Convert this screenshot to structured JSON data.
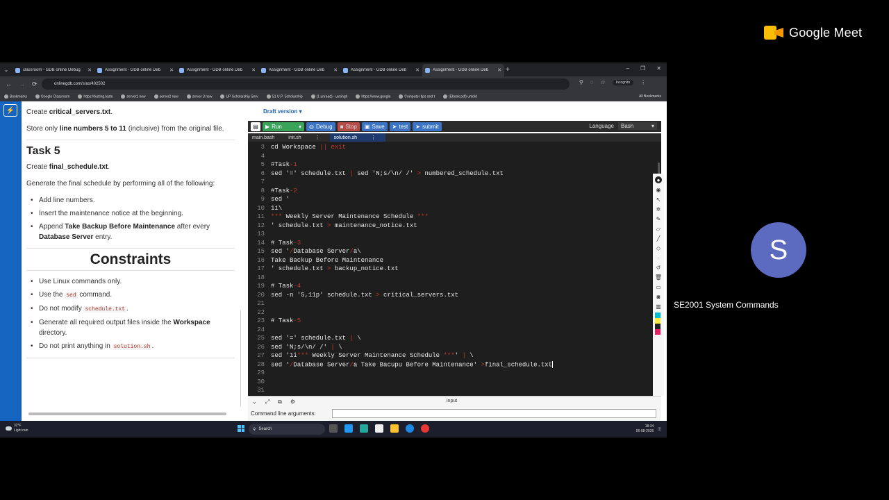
{
  "meet": {
    "brand": "Google Meet",
    "participant_initial": "S",
    "participant_name": "SE2001 System Commands",
    "avatar_color": "#5c6bc0"
  },
  "browser": {
    "tabs": [
      {
        "label": "classroom - GDB online Debug"
      },
      {
        "label": "Assignment - GDB online Deb"
      },
      {
        "label": "Assignment - GDB online Deb"
      },
      {
        "label": "Assignment - GDB online Deb"
      },
      {
        "label": "Assignment - GDB online Deb"
      },
      {
        "label": "Assignment - GDB online Deb",
        "active": true
      }
    ],
    "url": "onlinegdb.com/s/as/402502",
    "incognito_label": "Incognito",
    "bookmarks": [
      "Bookmarks",
      "Google Classroom",
      "https://testing.teste",
      "server1 new",
      "server2 new",
      "server 3 new",
      "UP Scholarship Serv",
      "S1 U.P. Scholarship",
      "(1 unread) - uvsingh",
      "https://www.google",
      "Computer tips and t",
      "(Ebook pdf) untold"
    ],
    "all_bookmarks": "All Bookmarks"
  },
  "task_panel": {
    "create_prefix": "Create ",
    "create_file": "critical_servers.txt",
    "create_suffix": ".",
    "store_prefix": "Store only ",
    "store_bold": "line numbers 5 to 11",
    "store_suffix": " (inclusive) from the original file.",
    "task5_heading": "Task 5",
    "task5_create_prefix": "Create ",
    "task5_create_file": "final_schedule.txt",
    "task5_create_suffix": ".",
    "task5_generate": "Generate the final schedule by performing all of the following:",
    "task5_items": {
      "i1": "Add line numbers.",
      "i2": "Insert the maintenance notice at the beginning.",
      "i3_prefix": "Append ",
      "i3_bold1": "Take Backup Before Maintenance",
      "i3_mid": " after every ",
      "i3_bold2": "Database Server",
      "i3_suffix": " entry."
    },
    "constraints_heading": "Constraints",
    "constraints": {
      "c1": "Use Linux commands only.",
      "c2_prefix": "Use the ",
      "c2_code": "sed",
      "c2_suffix": " command.",
      "c3_prefix": "Do not modify ",
      "c3_code": "schedule.txt",
      "c3_suffix": ".",
      "c4_prefix": "Generate all required output files inside the ",
      "c4_bold": "Workspace",
      "c4_suffix": " directory.",
      "c5_prefix": "Do not print anything in ",
      "c5_code": "solution.sh",
      "c5_suffix": "."
    }
  },
  "editor": {
    "draft_label": "Draft version ▾",
    "toolbar": {
      "run": "Run",
      "debug": "Debug",
      "stop": "Stop",
      "save": "Save",
      "test": "test",
      "submit": "submit",
      "language_label": "Language",
      "language_value": "Bash"
    },
    "file_tabs": [
      "main.bash",
      "init.sh",
      "solution.sh"
    ],
    "lines": [
      {
        "n": "3",
        "segs": [
          {
            "t": "cd Workspace ",
            "c": "#e8e8e8"
          },
          {
            "t": "|| exit",
            "c": "#c0392b"
          }
        ]
      },
      {
        "n": "4",
        "segs": []
      },
      {
        "n": "5",
        "segs": [
          {
            "t": "#Task",
            "c": "#e8e8e8"
          },
          {
            "t": "-1",
            "c": "#c0392b"
          }
        ]
      },
      {
        "n": "6",
        "segs": [
          {
            "t": "sed ",
            "c": "#e8e8e8"
          },
          {
            "t": "'='",
            "c": "#e8e8e8"
          },
          {
            "t": " schedule.txt ",
            "c": "#e8e8e8"
          },
          {
            "t": "|",
            "c": "#c0392b"
          },
          {
            "t": " sed 'N;s/\\n/ /' ",
            "c": "#e8e8e8"
          },
          {
            "t": ">",
            "c": "#c0392b"
          },
          {
            "t": " numbered_schedule.txt",
            "c": "#e8e8e8"
          }
        ]
      },
      {
        "n": "7",
        "segs": []
      },
      {
        "n": "8",
        "segs": [
          {
            "t": "#Task",
            "c": "#e8e8e8"
          },
          {
            "t": "-2",
            "c": "#c0392b"
          }
        ]
      },
      {
        "n": "9",
        "segs": [
          {
            "t": "sed '",
            "c": "#e8e8e8"
          }
        ]
      },
      {
        "n": "10",
        "segs": [
          {
            "t": "1i\\",
            "c": "#e8e8e8"
          }
        ]
      },
      {
        "n": "11",
        "segs": [
          {
            "t": "***",
            "c": "#c0392b"
          },
          {
            "t": " Weekly Server Maintenance Schedule ",
            "c": "#e8e8e8"
          },
          {
            "t": "***",
            "c": "#c0392b"
          }
        ]
      },
      {
        "n": "12",
        "segs": [
          {
            "t": "' schedule.txt ",
            "c": "#e8e8e8"
          },
          {
            "t": ">",
            "c": "#c0392b"
          },
          {
            "t": " maintenance_notice.txt",
            "c": "#e8e8e8"
          }
        ]
      },
      {
        "n": "13",
        "segs": []
      },
      {
        "n": "14",
        "segs": [
          {
            "t": "# Task",
            "c": "#e8e8e8"
          },
          {
            "t": "-3",
            "c": "#c0392b"
          }
        ]
      },
      {
        "n": "15",
        "segs": [
          {
            "t": "sed '",
            "c": "#e8e8e8"
          },
          {
            "t": "/",
            "c": "#c0392b"
          },
          {
            "t": "Database Server",
            "c": "#e8e8e8"
          },
          {
            "t": "/",
            "c": "#c0392b"
          },
          {
            "t": "a\\",
            "c": "#e8e8e8"
          }
        ]
      },
      {
        "n": "16",
        "segs": [
          {
            "t": "Take Backup Before Maintenance",
            "c": "#e8e8e8"
          }
        ]
      },
      {
        "n": "17",
        "segs": [
          {
            "t": "' schedule.txt ",
            "c": "#e8e8e8"
          },
          {
            "t": ">",
            "c": "#c0392b"
          },
          {
            "t": " backup_notice.txt",
            "c": "#e8e8e8"
          }
        ]
      },
      {
        "n": "18",
        "segs": []
      },
      {
        "n": "19",
        "segs": [
          {
            "t": "# Task",
            "c": "#e8e8e8"
          },
          {
            "t": "-4",
            "c": "#c0392b"
          }
        ]
      },
      {
        "n": "20",
        "segs": [
          {
            "t": "sed -n '5,11p' schedule.txt ",
            "c": "#e8e8e8"
          },
          {
            "t": ">",
            "c": "#c0392b"
          },
          {
            "t": " critical_servers.txt",
            "c": "#e8e8e8"
          }
        ]
      },
      {
        "n": "21",
        "segs": []
      },
      {
        "n": "22",
        "segs": []
      },
      {
        "n": "23",
        "segs": [
          {
            "t": "# Task",
            "c": "#e8e8e8"
          },
          {
            "t": "-5",
            "c": "#c0392b"
          }
        ]
      },
      {
        "n": "24",
        "segs": []
      },
      {
        "n": "25",
        "segs": [
          {
            "t": "sed '=' schedule.txt ",
            "c": "#e8e8e8"
          },
          {
            "t": "|",
            "c": "#c0392b"
          },
          {
            "t": " \\",
            "c": "#e8e8e8"
          }
        ]
      },
      {
        "n": "26",
        "segs": [
          {
            "t": "sed 'N;s/\\n/ /' ",
            "c": "#e8e8e8"
          },
          {
            "t": "|",
            "c": "#c0392b"
          },
          {
            "t": " \\",
            "c": "#e8e8e8"
          }
        ]
      },
      {
        "n": "27",
        "segs": [
          {
            "t": "sed '1i",
            "c": "#e8e8e8"
          },
          {
            "t": "***",
            "c": "#c0392b"
          },
          {
            "t": " Weekly Server Maintenance Schedule ",
            "c": "#e8e8e8"
          },
          {
            "t": "***",
            "c": "#c0392b"
          },
          {
            "t": "' ",
            "c": "#e8e8e8"
          },
          {
            "t": "|",
            "c": "#c0392b"
          },
          {
            "t": " \\",
            "c": "#e8e8e8"
          }
        ]
      },
      {
        "n": "28",
        "segs": [
          {
            "t": "sed '",
            "c": "#e8e8e8"
          },
          {
            "t": "/",
            "c": "#c0392b"
          },
          {
            "t": "Database Server",
            "c": "#e8e8e8"
          },
          {
            "t": "/",
            "c": "#c0392b"
          },
          {
            "t": "a Take Bacupu Before Maintenance' ",
            "c": "#e8e8e8"
          },
          {
            "t": ">",
            "c": "#c0392b"
          },
          {
            "t": "final_schedule.txt",
            "c": "#e8e8e8"
          }
        ],
        "cursor": true
      },
      {
        "n": "29",
        "segs": []
      },
      {
        "n": "30",
        "segs": []
      },
      {
        "n": "31",
        "segs": []
      }
    ],
    "io": {
      "title": "input",
      "cmd_label": "Command line arguments:"
    }
  },
  "taskbar": {
    "temp": "32°F",
    "weather": "Light rain",
    "search": "Search",
    "time": "18:34",
    "date": "06-08-2026"
  }
}
